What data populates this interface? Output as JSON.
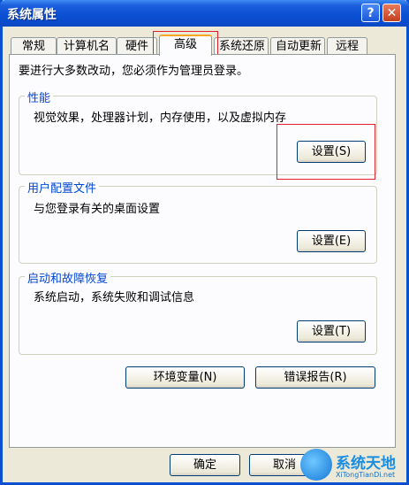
{
  "window": {
    "title": "系统属性"
  },
  "titlebar": {
    "help_glyph": "?",
    "close_glyph": "✕"
  },
  "tabs": [
    {
      "label": "常规"
    },
    {
      "label": "计算机名"
    },
    {
      "label": "硬件"
    },
    {
      "label": "高级"
    },
    {
      "label": "系统还原"
    },
    {
      "label": "自动更新"
    },
    {
      "label": "远程"
    }
  ],
  "intro": "要进行大多数改动，您必须作为管理员登录。",
  "performance": {
    "title": "性能",
    "desc": "视觉效果，处理器计划，内存使用，以及虚拟内存",
    "button": "设置(S)"
  },
  "profile": {
    "title": "用户配置文件",
    "desc": "与您登录有关的桌面设置",
    "button": "设置(E)"
  },
  "startup": {
    "title": "启动和故障恢复",
    "desc": "系统启动，系统失败和调试信息",
    "button": "设置(T)"
  },
  "env_button": "环境变量(N)",
  "error_button": "错误报告(R)",
  "ok_button": "确定",
  "cancel_button": "取消",
  "watermark": {
    "text": "系统天地",
    "sub": "XiTongTianDi.net"
  },
  "colors": {
    "highlight_box": "#e0202a",
    "group_label": "#0046d5",
    "title_bar": "#0a4fd3"
  }
}
